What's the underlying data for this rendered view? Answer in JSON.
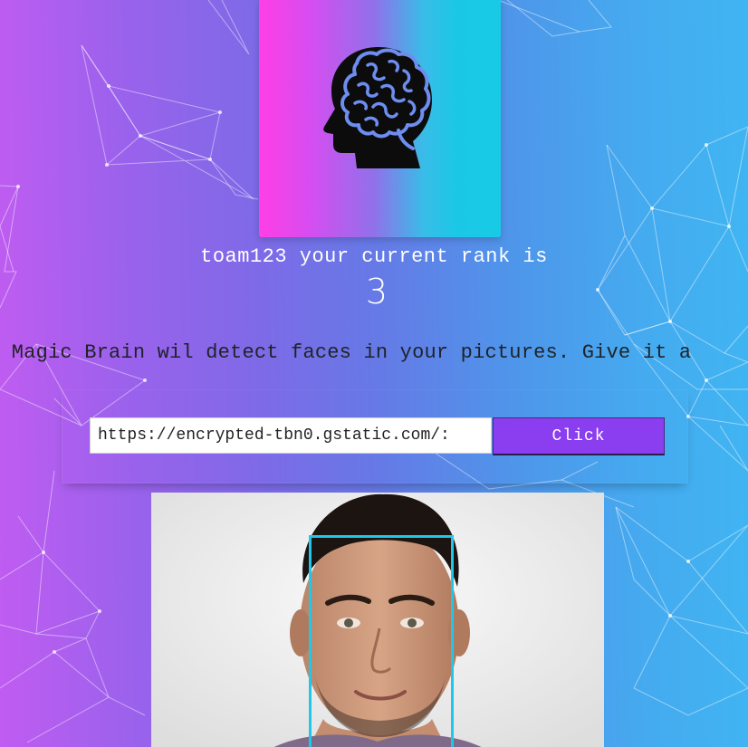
{
  "logo": {
    "icon": "brain-head-icon"
  },
  "rank": {
    "text": "toam123 your current rank is",
    "value": "3"
  },
  "description": "s Magic Brain wil detect faces in your pictures. Give it a",
  "form": {
    "url_value": "https://encrypted-tbn0.gstatic.com/:",
    "button_label": "Click"
  },
  "photo": {
    "subject": "face-photo",
    "face_box_color": "#1fc7e8"
  },
  "colors": {
    "button": "#8a3ef0",
    "gradient_left": "#c05cf1",
    "gradient_right": "#40b5f2"
  }
}
